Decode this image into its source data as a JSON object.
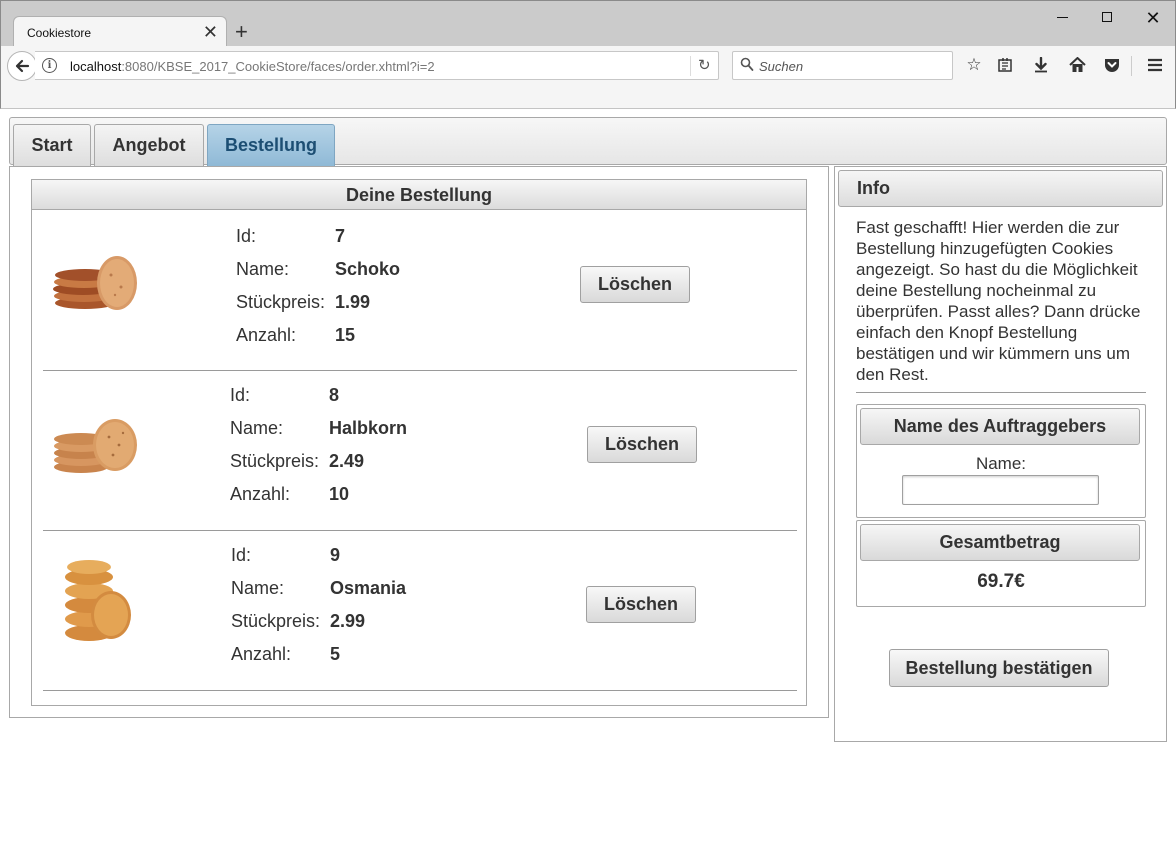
{
  "browser": {
    "tab_title": "Cookiestore",
    "url_host": "localhost",
    "url_rest": ":8080/KBSE_2017_CookieStore/faces/order.xhtml?i=2",
    "search_placeholder": "Suchen"
  },
  "menu": {
    "items": [
      {
        "label": "Start",
        "active": false
      },
      {
        "label": "Angebot",
        "active": false
      },
      {
        "label": "Bestellung",
        "active": true
      }
    ]
  },
  "order": {
    "title": "Deine Bestellung",
    "field_labels": {
      "id": "Id:",
      "name": "Name:",
      "price": "Stückpreis:",
      "count": "Anzahl:"
    },
    "delete_label": "Löschen",
    "items": [
      {
        "id": "7",
        "name": "Schoko",
        "price": "1.99",
        "count": "15",
        "image": "chocolate-cookie-stack"
      },
      {
        "id": "8",
        "name": "Halbkorn",
        "price": "2.49",
        "count": "10",
        "image": "oat-cookie-stack"
      },
      {
        "id": "9",
        "name": "Osmania",
        "price": "2.99",
        "count": "5",
        "image": "golden-cookie-stack"
      }
    ]
  },
  "info": {
    "title": "Info",
    "text": "Fast geschafft! Hier werden die zur Bestellung hinzugefügten Cookies angezeigt. So hast du die Möglichkeit deine Bestellung nocheinmal zu überprüfen. Passt alles? Dann drücke einfach den Knopf Bestellung bestätigen und wir kümmern uns um den Rest.",
    "customer_header": "Name des Auftraggebers",
    "name_label": "Name:",
    "name_value": "",
    "total_header": "Gesamtbetrag",
    "total_value": "69.7€",
    "confirm_label": "Bestellung bestätigen"
  },
  "colors": {
    "active_tab": "#9fc5e0",
    "active_tab_text": "#1c4e73"
  }
}
